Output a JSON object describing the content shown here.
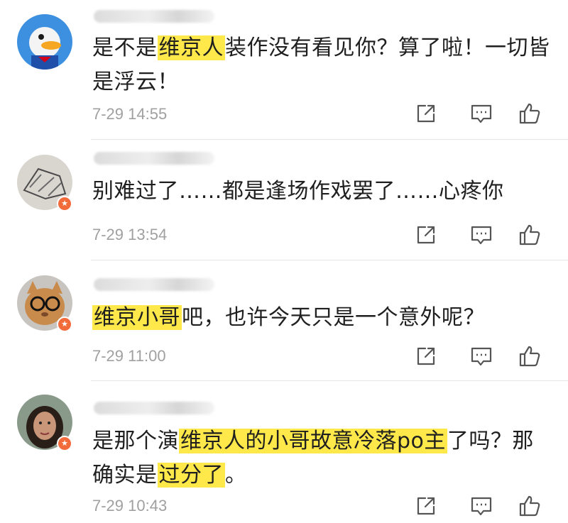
{
  "comments": [
    {
      "segments": [
        {
          "text": "是不是",
          "hl": false
        },
        {
          "text": "维京人",
          "hl": true
        },
        {
          "text": "装作没有看见你？算了啦！一切皆是浮云！",
          "hl": false
        }
      ],
      "time": "7-29 14:55",
      "avatar": "donald-duck",
      "badge": false
    },
    {
      "segments": [
        {
          "text": "别难过了……都是逢场作戏罢了……心疼你",
          "hl": false
        }
      ],
      "time": "7-29 13:54",
      "avatar": "sketch",
      "badge": true
    },
    {
      "segments": [
        {
          "text": "维京小哥",
          "hl": true
        },
        {
          "text": "吧，也许今天只是一个意外呢？",
          "hl": false
        }
      ],
      "time": "7-29 11:00",
      "avatar": "cat-glasses",
      "badge": true
    },
    {
      "segments": [
        {
          "text": "是那个演",
          "hl": false
        },
        {
          "text": "维京人的小哥故意冷落po主",
          "hl": true
        },
        {
          "text": "了吗？那确实是",
          "hl": false
        },
        {
          "text": "过分了",
          "hl": true
        },
        {
          "text": "。",
          "hl": false
        }
      ],
      "time": "7-29 10:43",
      "avatar": "woman",
      "badge": true
    }
  ],
  "icons": {
    "share": "share-icon",
    "reply": "comment-icon",
    "like": "thumbs-up-icon",
    "badge": "star-badge-icon"
  },
  "colors": {
    "highlight": "#ffe84a",
    "timestamp": "#a0a0a0",
    "badge": "#f26b3a"
  }
}
